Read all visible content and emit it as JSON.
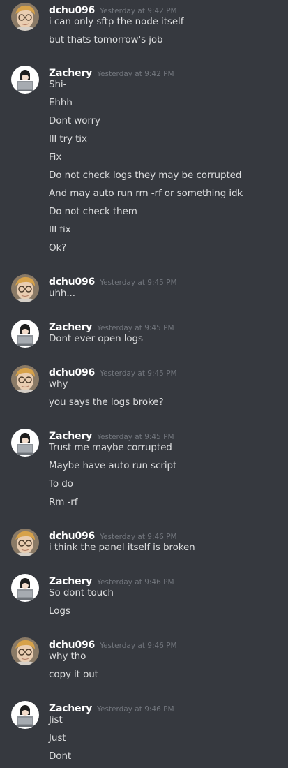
{
  "groups": [
    {
      "author": "dchu096",
      "avatar": "person-avatar",
      "time": "Yesterday at 9:42 PM",
      "lines": [
        "i can only sftp the node itself",
        "but thats tomorrow's job"
      ]
    },
    {
      "author": "Zachery",
      "avatar": "laptop-avatar",
      "time": "Yesterday at 9:42 PM",
      "lines": [
        "Shi-",
        "Ehhh",
        "Dont worry",
        "Ill try tix",
        "Fix",
        "Do not check logs they may be corrupted",
        "And may auto run rm -rf or something idk",
        "Do not check them",
        "Ill fix",
        "Ok?"
      ]
    },
    {
      "author": "dchu096",
      "avatar": "person-avatar",
      "time": "Yesterday at 9:45 PM",
      "lines": [
        "uhh..."
      ]
    },
    {
      "author": "Zachery",
      "avatar": "laptop-avatar",
      "time": "Yesterday at 9:45 PM",
      "lines": [
        "Dont ever open logs"
      ]
    },
    {
      "author": "dchu096",
      "avatar": "person-avatar",
      "time": "Yesterday at 9:45 PM",
      "lines": [
        "why",
        "you says the logs broke?"
      ]
    },
    {
      "author": "Zachery",
      "avatar": "laptop-avatar",
      "time": "Yesterday at 9:45 PM",
      "lines": [
        "Trust me maybe corrupted",
        "Maybe have auto run script",
        "To do",
        "Rm -rf"
      ]
    },
    {
      "author": "dchu096",
      "avatar": "person-avatar",
      "time": "Yesterday at 9:46 PM",
      "lines": [
        "i think the panel itself is broken"
      ]
    },
    {
      "author": "Zachery",
      "avatar": "laptop-avatar",
      "time": "Yesterday at 9:46 PM",
      "lines": [
        "So dont touch",
        "Logs"
      ]
    },
    {
      "author": "dchu096",
      "avatar": "person-avatar",
      "time": "Yesterday at 9:46 PM",
      "lines": [
        "why tho",
        "copy it out"
      ]
    },
    {
      "author": "Zachery",
      "avatar": "laptop-avatar",
      "time": "Yesterday at 9:46 PM",
      "lines": [
        "Jist",
        "Just",
        "Dont"
      ]
    }
  ],
  "colors": {
    "background": "#36393f",
    "username": "#ffffff",
    "timestamp": "#72767d",
    "text": "#dcddde"
  }
}
